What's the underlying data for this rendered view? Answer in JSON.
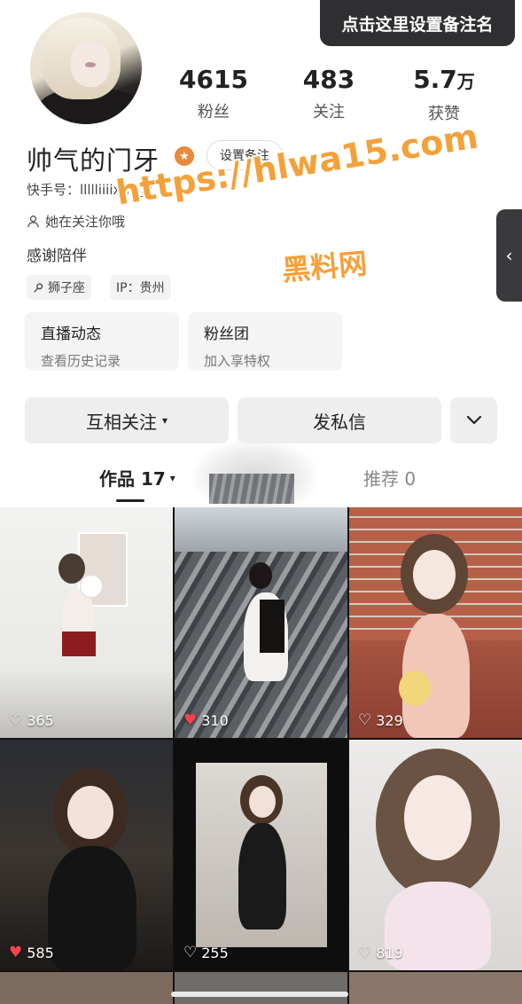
{
  "header": {
    "set_note_button": "点击这里设置备注名"
  },
  "stats": [
    {
      "value": "4615",
      "unit": "",
      "label": "粉丝"
    },
    {
      "value": "483",
      "unit": "",
      "label": "关注"
    },
    {
      "value": "5.7",
      "unit": "万",
      "label": "获赞"
    }
  ],
  "profile": {
    "name": "帅气的门牙",
    "badge_symbol": "★",
    "remark_button": "设置备注",
    "kuaishou_id": "快手号：llllliiiixni",
    "follows_you": "她在关注你哦",
    "bio": "感谢陪伴",
    "tags": [
      {
        "icon": "zodiac-icon",
        "label": "狮子座"
      },
      {
        "icon": "",
        "label": "IP：贵州"
      }
    ]
  },
  "watermark": {
    "url": "https://hlwa15.com",
    "sub": "黑料网"
  },
  "side_tab": {
    "icon": "chevron-left-icon",
    "glyph": "‹"
  },
  "cards": [
    {
      "title": "直播动态",
      "subtitle": "查看历史记录"
    },
    {
      "title": "粉丝团",
      "subtitle": "加入享特权"
    }
  ],
  "actions": {
    "follow": "互相关注",
    "follow_caret": "▾",
    "message": "发私信",
    "more_glyph": "⌄"
  },
  "tabs": {
    "works": "作品 17",
    "works_caret": "▾",
    "recommend": "推荐 0"
  },
  "posts": [
    {
      "likes": "365",
      "liked": false
    },
    {
      "likes": "310",
      "liked": true
    },
    {
      "likes": "329",
      "liked": false
    },
    {
      "likes": "585",
      "liked": true
    },
    {
      "likes": "255",
      "liked": false
    },
    {
      "likes": "819",
      "liked": false
    }
  ],
  "colors": {
    "accent_heart": "#f2434f",
    "watermark": "#f4a13a",
    "badge": "#e8893c"
  }
}
